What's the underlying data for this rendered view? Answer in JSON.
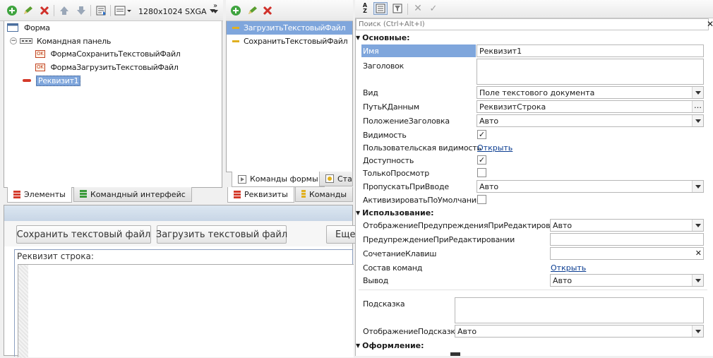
{
  "left_toolbar": {
    "resolution": "1280x1024 SXGA"
  },
  "elements_tree": {
    "items": [
      {
        "label": "Форма"
      },
      {
        "label": "Командная панель"
      },
      {
        "label": "ФормаСохранитьТекстовыйФайл",
        "badge": "OK"
      },
      {
        "label": "ФормаЗагрузитьТекстовыйФайл",
        "badge": "OK"
      },
      {
        "label": "Реквизит1"
      }
    ]
  },
  "left_tabs": {
    "elements": "Элементы",
    "command_interface": "Командный интерфейс"
  },
  "commands_list": {
    "items": [
      {
        "label": "ЗагрузитьТекстовыйФайл"
      },
      {
        "label": "СохранитьТекстовыйФайл"
      }
    ]
  },
  "middle_tabs": {
    "form_commands": "Команды формы",
    "standard": "Ста",
    "attributes": "Реквизиты",
    "commands": "Команды"
  },
  "preview": {
    "save_button": "Сохранить текстовый файл",
    "load_button": "Загрузить текстовый файл",
    "more_button": "Еще",
    "field_title": "Реквизит строка:"
  },
  "properties": {
    "search_placeholder": "Поиск (Ctrl+Alt+I)",
    "sections": {
      "main": "Основные:",
      "usage": "Использование:",
      "design": "Оформление:"
    },
    "rows": {
      "name_label": "Имя",
      "name_value": "Реквизит1",
      "title_label": "Заголовок",
      "title_value": "",
      "kind_label": "Вид",
      "kind_value": "Поле текстового документа",
      "datapath_label": "ПутьКДанным",
      "datapath_value": "РеквизитСтрока",
      "title_pos_label": "ПоложениеЗаголовка",
      "title_pos_value": "Авто",
      "visible_label": "Видимость",
      "visible_checked": true,
      "user_visible_label": "Пользовательская видимость",
      "user_visible_link": "Открыть",
      "enabled_label": "Доступность",
      "enabled_checked": true,
      "readonly_label": "ТолькоПросмотр",
      "readonly_checked": false,
      "skip_label": "ПропускатьПриВводе",
      "skip_value": "Авто",
      "activate_label": "АктивизироватьПоУмолчанию",
      "activate_checked": false,
      "edit_warn_display_label": "ОтображениеПредупрежденияПриРедактировании",
      "edit_warn_display_value": "Авто",
      "edit_warn_label": "ПредупреждениеПриРедактировании",
      "edit_warn_value": "",
      "shortcut_label": "СочетаниеКлавиш",
      "shortcut_value": "",
      "commands_label": "Состав команд",
      "commands_link": "Открыть",
      "output_label": "Вывод",
      "output_value": "Авто",
      "tooltip_label": "Подсказка",
      "tooltip_value": "",
      "tooltip_display_label": "ОтображениеПодсказки",
      "tooltip_display_value": "Авто"
    }
  },
  "colors": {
    "selection": "#7fa6dc",
    "tab_red": "#d43a2a",
    "tab_green": "#3a9a3a",
    "tab_yellow": "#e0b020",
    "link": "#0b3d91"
  }
}
